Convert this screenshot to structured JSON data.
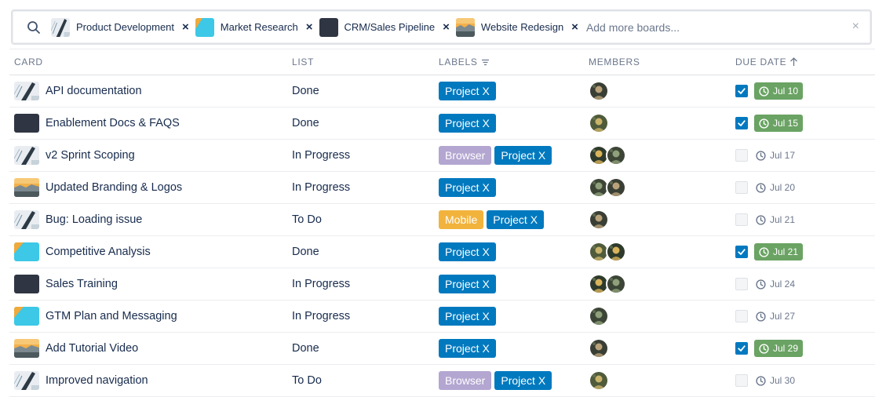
{
  "search": {
    "placeholder": "Add more boards...",
    "chips": [
      {
        "label": "Product Development",
        "thumb": "sketch",
        "remove": "×"
      },
      {
        "label": "Market Research",
        "thumb": "teal",
        "remove": "×"
      },
      {
        "label": "CRM/Sales Pipeline",
        "thumb": "dark",
        "remove": "×"
      },
      {
        "label": "Website Redesign",
        "thumb": "landscape",
        "remove": "×"
      }
    ],
    "clear_all": "×"
  },
  "columns": {
    "card": "CARD",
    "list": "LIST",
    "labels": "LABELS",
    "members": "MEMBERS",
    "due": "DUE DATE"
  },
  "colors": {
    "project_x": "#0079bf",
    "browser": "#b3a6d1",
    "mobile": "#f2b33d",
    "due_done": "#6aa363",
    "checkbox_on": "#0079bf"
  },
  "rows": [
    {
      "card": "API documentation",
      "thumb": "sketch",
      "list": "Done",
      "labels": [
        "Project X"
      ],
      "members": 1,
      "done": true,
      "due": "Jul 10"
    },
    {
      "card": "Enablement Docs & FAQS",
      "thumb": "dark",
      "list": "Done",
      "labels": [
        "Project X"
      ],
      "members": 1,
      "done": true,
      "due": "Jul 15"
    },
    {
      "card": "v2 Sprint Scoping",
      "thumb": "sketch",
      "list": "In Progress",
      "labels": [
        "Browser",
        "Project X"
      ],
      "members": 2,
      "done": false,
      "due": "Jul 17"
    },
    {
      "card": "Updated Branding & Logos",
      "thumb": "landscape",
      "list": "In Progress",
      "labels": [
        "Project X"
      ],
      "members": 2,
      "done": false,
      "due": "Jul 20"
    },
    {
      "card": "Bug: Loading issue",
      "thumb": "sketch",
      "list": "To Do",
      "labels": [
        "Mobile",
        "Project X"
      ],
      "members": 1,
      "done": false,
      "due": "Jul 21"
    },
    {
      "card": "Competitive Analysis",
      "thumb": "teal",
      "list": "Done",
      "labels": [
        "Project X"
      ],
      "members": 2,
      "done": true,
      "due": "Jul 21"
    },
    {
      "card": "Sales Training",
      "thumb": "dark",
      "list": "In Progress",
      "labels": [
        "Project X"
      ],
      "members": 2,
      "done": false,
      "due": "Jul 24"
    },
    {
      "card": "GTM Plan and Messaging",
      "thumb": "teal",
      "list": "In Progress",
      "labels": [
        "Project X"
      ],
      "members": 1,
      "done": false,
      "due": "Jul 27"
    },
    {
      "card": "Add Tutorial Video",
      "thumb": "landscape",
      "list": "Done",
      "labels": [
        "Project X"
      ],
      "members": 1,
      "done": true,
      "due": "Jul 29"
    },
    {
      "card": "Improved navigation",
      "thumb": "sketch",
      "list": "To Do",
      "labels": [
        "Browser",
        "Project X"
      ],
      "members": 1,
      "done": false,
      "due": "Jul 30"
    }
  ]
}
